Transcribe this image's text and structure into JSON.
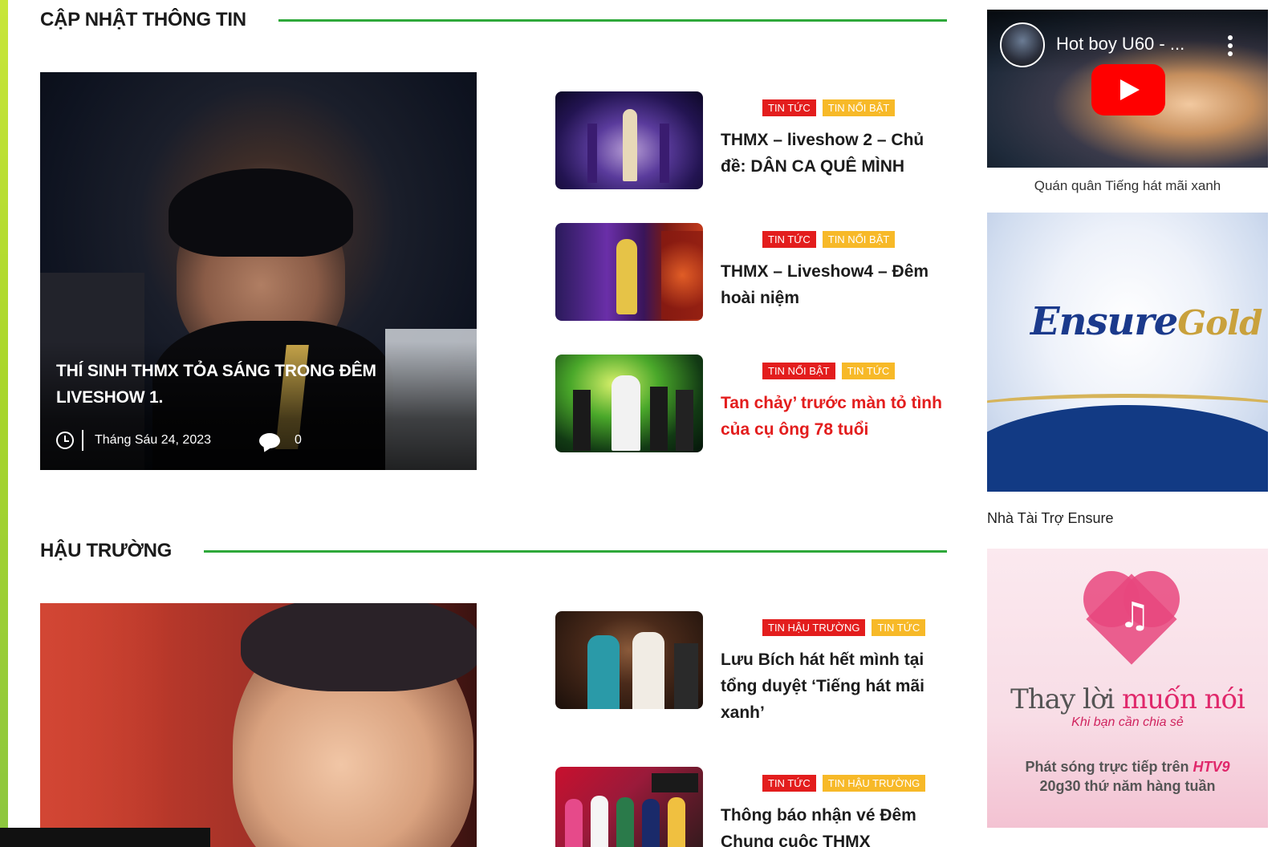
{
  "sections": [
    {
      "title": "CẬP NHẬT THÔNG TIN",
      "feature": {
        "title": "THÍ SINH THMX TỎA SÁNG TRONG ĐÊM LIVESHOW 1.",
        "date": "Tháng Sáu 24, 2023",
        "comments": "0"
      },
      "items": [
        {
          "badges": [
            "TIN TỨC",
            "TIN NỔI BẬT"
          ],
          "badge_colors": [
            "red",
            "yellow"
          ],
          "title": "THMX – liveshow 2 – Chủ đề: DÂN CA QUÊ MÌNH",
          "highlight": false
        },
        {
          "badges": [
            "TIN TỨC",
            "TIN NỔI BẬT"
          ],
          "badge_colors": [
            "red",
            "yellow"
          ],
          "title": "THMX – Liveshow4 – Đêm hoài niệm",
          "highlight": false
        },
        {
          "badges": [
            "TIN NỔI BẬT",
            "TIN TỨC"
          ],
          "badge_colors": [
            "red",
            "yellow"
          ],
          "title": "Tan chảy’ trước màn tỏ tình của cụ ông 78 tuổi",
          "highlight": true
        }
      ]
    },
    {
      "title": "HẬU TRƯỜNG",
      "items": [
        {
          "badges": [
            "TIN HẬU TRƯỜNG",
            "TIN TỨC"
          ],
          "badge_colors": [
            "red",
            "yellow"
          ],
          "title": "Lưu Bích hát hết mình tại tổng duyệt ‘Tiếng hát mãi xanh’",
          "highlight": false
        },
        {
          "badges": [
            "TIN TỨC",
            "TIN HẬU TRƯỜNG"
          ],
          "badge_colors": [
            "red",
            "yellow"
          ],
          "title": "Thông báo nhận vé Đêm Chung cuộc THMX",
          "highlight": false
        }
      ]
    }
  ],
  "sidebar": {
    "video": {
      "title": "Hot boy U60 - ...",
      "caption": "Quán quân Tiếng hát mãi xanh"
    },
    "ensure": {
      "logo": "Ensure",
      "logo_sub": "Gold",
      "caption": "Nhà Tài Trợ Ensure"
    },
    "promo": {
      "title_a": "Thay lời ",
      "title_b": "muốn nói",
      "subtitle": "Khi bạn cần chia sẻ",
      "line1": "Phát sóng trực tiếp trên ",
      "channel": "HTV9",
      "line2": "20g30 thứ năm hàng tuần"
    }
  },
  "colors": {
    "accent_green": "#2ea83a",
    "badge_red": "#e31d1d",
    "badge_yellow": "#f7b928",
    "highlight_red": "#e31d1d"
  }
}
